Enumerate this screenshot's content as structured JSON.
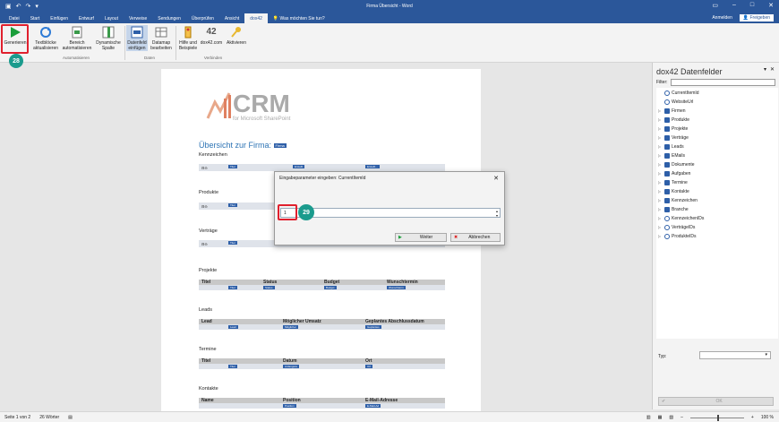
{
  "window": {
    "title": "Firma Übersicht - Word"
  },
  "tabs": [
    "Datei",
    "Start",
    "Einfügen",
    "Entwurf",
    "Layout",
    "Verweise",
    "Sendungen",
    "Überprüfen",
    "Ansicht",
    "dox42"
  ],
  "tellme": "Was möchten Sie tun?",
  "account": {
    "signin": "Anmelden",
    "share": "Freigeben"
  },
  "ribbon": {
    "generate": "Generieren",
    "textblocks": "Textblöcke aktualisieren",
    "area": "Bereich automatisieren",
    "dyncols": "Dynamische Spalte",
    "datafield": "Datenfeld einfügen",
    "datamap": "Datamap bearbeiten",
    "help": "Hilfe und Beispiele",
    "dox42com": "dox42.com",
    "activate": "Aktivieren",
    "group_automatisieren": "Automatisieren",
    "group_daten": "Daten",
    "group_verbinden": "Verbinden"
  },
  "badges": {
    "b28": "28",
    "b29": "29"
  },
  "doc": {
    "logo_text": "CRM",
    "logo_sub": "for Microsoft SharePoint",
    "heading": "Übersicht zur Firma:",
    "firma_field": "Firma",
    "sections": [
      {
        "label": "Kennzeichen",
        "headers": [],
        "fields": [
          "Titel",
          "Erstellt",
          "Erstellt..."
        ]
      },
      {
        "label": "Produkte",
        "headers": [],
        "fields": [
          "Titel",
          "Firma",
          "Firma"
        ]
      },
      {
        "label": "Verträge",
        "headers": [],
        "fields": [
          "Titel",
          "Firma",
          "Firma"
        ]
      },
      {
        "label": "Projekte",
        "headers": [
          "Titel",
          "Status",
          "Budget",
          "Wunschtermin"
        ],
        "fields": [
          "Titel",
          "Status",
          "Budget",
          "Wunschterm"
        ]
      },
      {
        "label": "Leads",
        "headers": [
          "Lead",
          "Möglicher Umsatz",
          "Geplantes Abschlussdatum"
        ],
        "fields": [
          "Lead",
          "Möglicher",
          "Geplantes"
        ]
      },
      {
        "label": "Termine",
        "headers": [
          "Titel",
          "Datum",
          "Ort"
        ],
        "fields": [
          "Titel",
          "Anfangsze",
          "Ort"
        ]
      },
      {
        "label": "Kontakte",
        "headers": [
          "Name",
          "Position",
          "E-Mail-Adresse"
        ],
        "fields": [
          "",
          "Position",
          "E-Mail-Ad"
        ]
      }
    ]
  },
  "dialog": {
    "title": "Eingabeparameter eingeben: CurrentItemId",
    "value": "1",
    "ok": "Weiter",
    "cancel": "Abbrechen"
  },
  "pane": {
    "title": "dox42 Datenfelder",
    "filter_label": "Filter:",
    "type_label": "Typ:",
    "ok": "OK",
    "items": [
      "CurrentItemId",
      "WebsiteUrl",
      "Firmen",
      "Produkte",
      "Projekte",
      "Verträge",
      "Leads",
      "EMails",
      "Dokumente",
      "Aufgaben",
      "Termine",
      "Kontakte",
      "Kennzeichen",
      "Branche",
      "KennzeichenIDs",
      "VerträgeIDs",
      "ProdukteIDs"
    ]
  },
  "status": {
    "page": "Seite 1 von 2",
    "words": "26 Wörter",
    "zoom": "100 %"
  }
}
